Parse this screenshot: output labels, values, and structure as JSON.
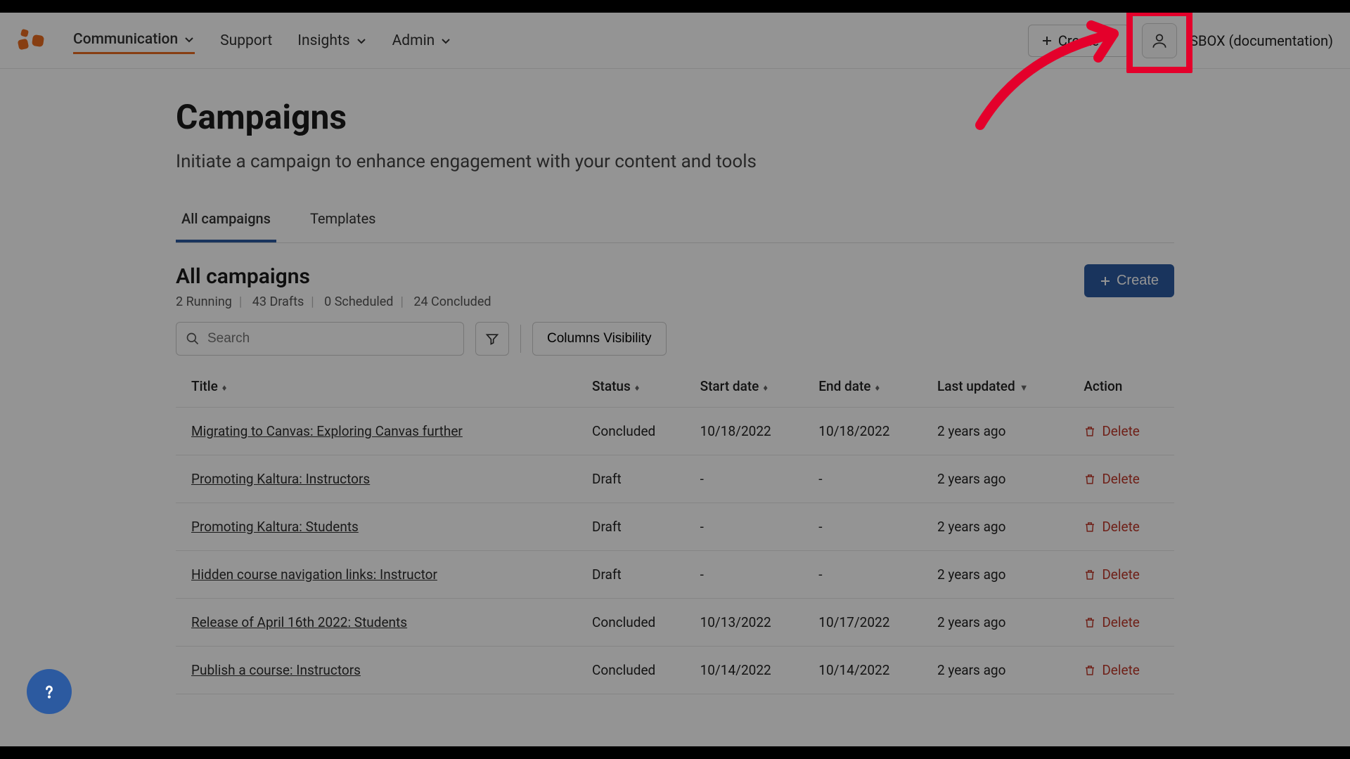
{
  "nav": {
    "items": [
      "Communication",
      "Support",
      "Insights",
      "Admin"
    ],
    "activeIndex": 0
  },
  "topbar": {
    "create_label": "Create",
    "org_label": "SBOX (documentation)"
  },
  "page": {
    "title": "Campaigns",
    "subtitle": "Initiate a campaign to enhance engagement with your content and tools"
  },
  "tabs": {
    "items": [
      "All campaigns",
      "Templates"
    ],
    "activeIndex": 0
  },
  "section": {
    "heading": "All campaigns",
    "counts": {
      "running": "2 Running",
      "drafts": "43 Drafts",
      "scheduled": "0 Scheduled",
      "concluded": "24 Concluded"
    },
    "create_label": "Create"
  },
  "tools": {
    "search_placeholder": "Search",
    "columns_visibility_label": "Columns Visibility"
  },
  "columns": [
    "Title",
    "Status",
    "Start date",
    "End date",
    "Last updated",
    "Action"
  ],
  "delete_label": "Delete",
  "rows": [
    {
      "title": "Migrating to Canvas: Exploring Canvas further",
      "status": "Concluded",
      "start": "10/18/2022",
      "end": "10/18/2022",
      "updated": "2 years ago"
    },
    {
      "title": "Promoting Kaltura: Instructors",
      "status": "Draft",
      "start": "-",
      "end": "-",
      "updated": "2 years ago"
    },
    {
      "title": "Promoting Kaltura: Students",
      "status": "Draft",
      "start": "-",
      "end": "-",
      "updated": "2 years ago"
    },
    {
      "title": "Hidden course navigation links: Instructor",
      "status": "Draft",
      "start": "-",
      "end": "-",
      "updated": "2 years ago"
    },
    {
      "title": "Release of April 16th 2022: Students",
      "status": "Concluded",
      "start": "10/13/2022",
      "end": "10/17/2022",
      "updated": "2 years ago"
    },
    {
      "title": "Publish a course: Instructors",
      "status": "Concluded",
      "start": "10/14/2022",
      "end": "10/14/2022",
      "updated": "2 years ago"
    }
  ],
  "annotation": {
    "highlight_target": "user-button",
    "arrow_color": "#e4002b"
  }
}
